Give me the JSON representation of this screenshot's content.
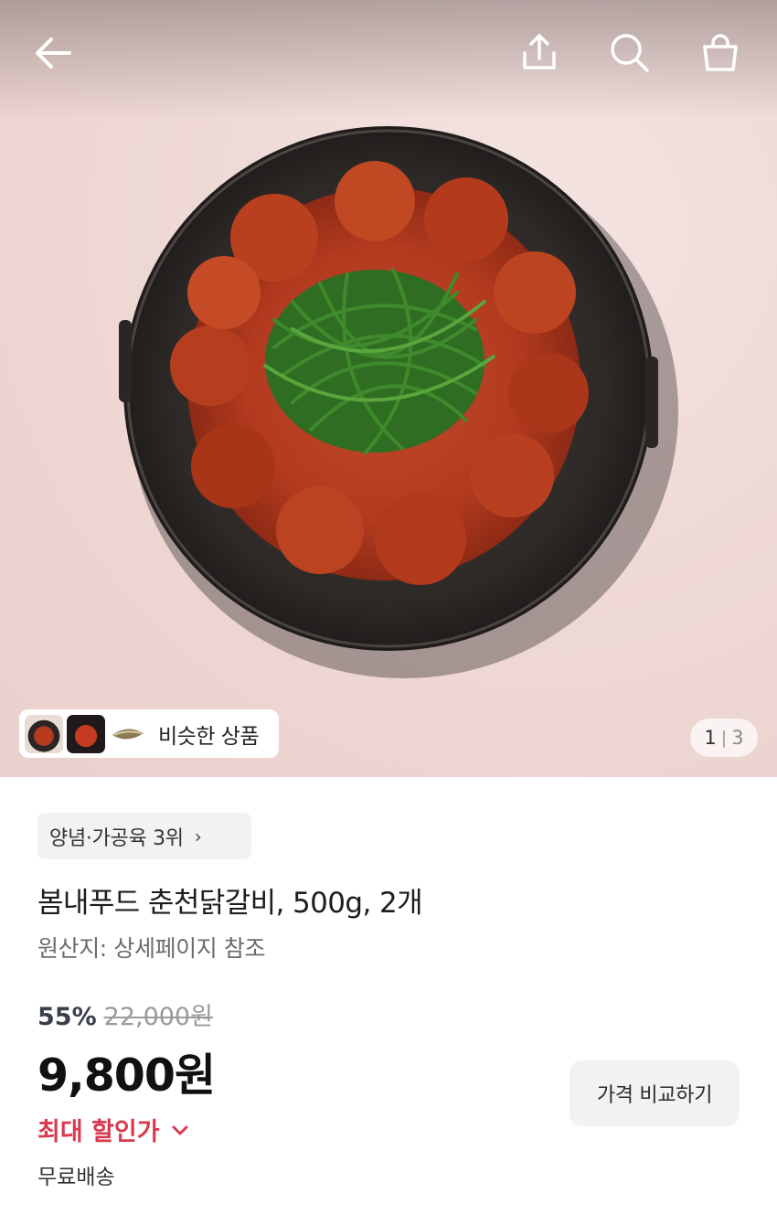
{
  "header": {
    "icons": [
      "back-arrow-icon",
      "share-icon",
      "search-icon",
      "shopping-bag-icon"
    ]
  },
  "gallery": {
    "similar_label": "비슷한 상품",
    "current_page": "1",
    "separator": "|",
    "total_pages": "3"
  },
  "product": {
    "rank_badge": "양념·가공육 3위",
    "rank_chevron": "›",
    "title": "봄내푸드 춘천닭갈비, 500g, 2개",
    "origin": "원산지: 상세페이지 참조"
  },
  "price": {
    "discount_rate": "55%",
    "original_price": "22,000원",
    "sale_price": "9,800원",
    "max_discount_label": "최대 할인가",
    "shipping": "무료배송",
    "compare_button": "가격 비교하기"
  },
  "colors": {
    "discount_accent": "#d9394e",
    "chip_background": "#f1f2f4"
  }
}
